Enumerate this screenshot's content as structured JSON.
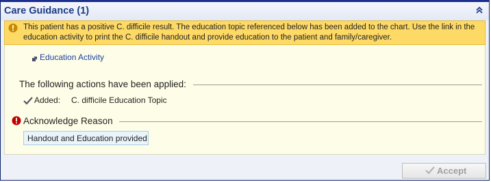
{
  "panel": {
    "title": "Care Guidance (1)"
  },
  "alert": {
    "text": "This patient has a positive C. difficile result. The education topic referenced below has been added to the chart. Use the link in the education activity to print the C. difficile handout and provide education to the patient and family/caregiver.",
    "background": "#fdd966"
  },
  "education": {
    "link_label": "Education Activity"
  },
  "actions": {
    "heading": "The following actions have been applied:",
    "items": [
      {
        "label": "Added:",
        "value": "C. difficile Education Topic"
      }
    ]
  },
  "acknowledge": {
    "heading": "Acknowledge Reason",
    "selected_reason": "Handout and Education provided"
  },
  "footer": {
    "accept_label": "Accept",
    "accept_enabled": false
  },
  "colors": {
    "title": "#1c3a87",
    "link": "#1d3e9e",
    "error": "#c00000"
  }
}
